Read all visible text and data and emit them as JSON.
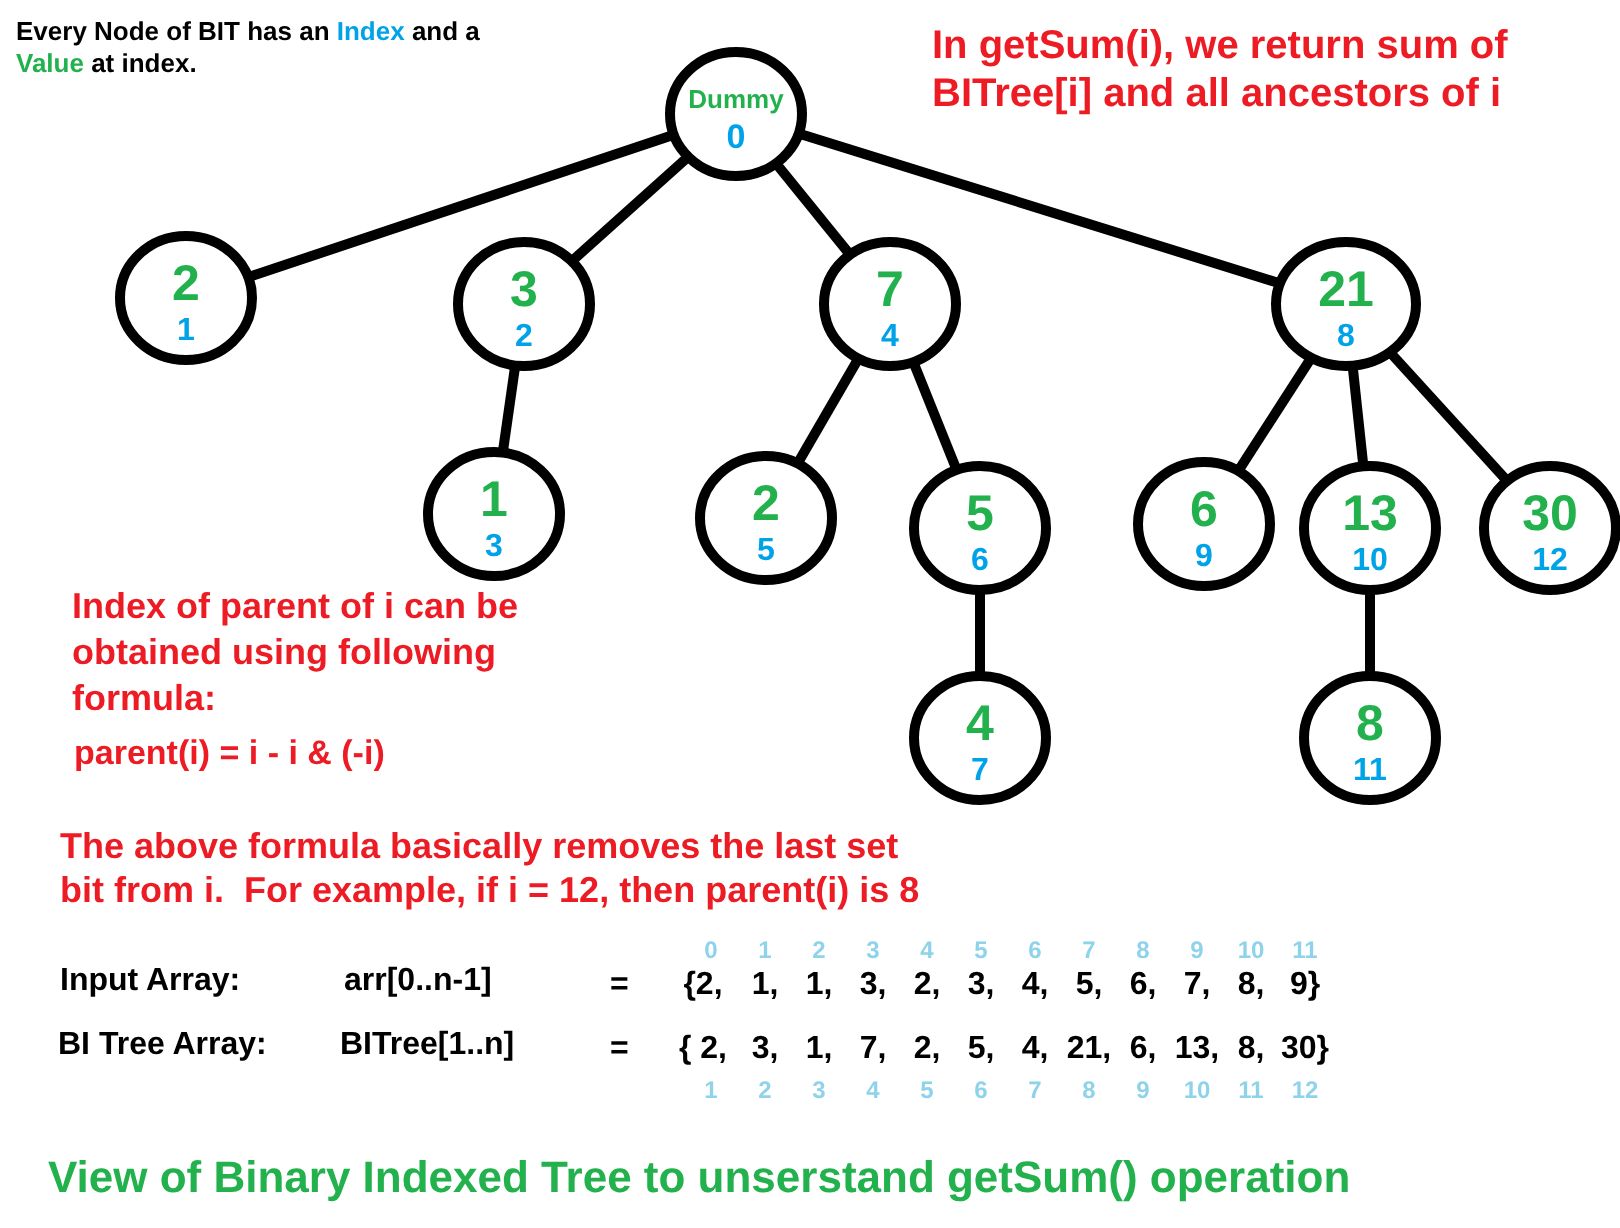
{
  "intro": [
    {
      "kind": "plain",
      "text": "Every Node of BIT has an "
    },
    {
      "kind": "index",
      "text": "Index"
    },
    {
      "kind": "plain",
      "text": " and a "
    },
    {
      "kind": "value",
      "text": "Value"
    },
    {
      "kind": "plain",
      "text": " at index."
    }
  ],
  "tree": {
    "value": "Dummy",
    "index": "0",
    "children": [
      {
        "value": "2",
        "index": "1"
      },
      {
        "value": "3",
        "index": "2",
        "children": [
          {
            "value": "1",
            "index": "3"
          }
        ]
      },
      {
        "value": "7",
        "index": "4",
        "children": [
          {
            "value": "2",
            "index": "5"
          },
          {
            "value": "5",
            "index": "6",
            "children": [
              {
                "value": "4",
                "index": "7"
              }
            ]
          }
        ]
      },
      {
        "value": "21",
        "index": "8",
        "children": [
          {
            "value": "6",
            "index": "9"
          },
          {
            "value": "13",
            "index": "10",
            "children": [
              {
                "value": "8",
                "index": "11"
              }
            ]
          },
          {
            "value": "30",
            "index": "12"
          }
        ]
      }
    ]
  },
  "get_sum_note": {
    "lines": [
      "In getSum(i), we return sum of",
      "BITree[i] and all ancestors of i"
    ]
  },
  "parent_note": {
    "lines": [
      "Index of parent of i can be",
      "obtained using following",
      "formula:"
    ]
  },
  "formula": "parent(i) = i - i & (-i)",
  "explanation": {
    "lines": [
      "The above formula basically removes the last set",
      "bit from i.  For example, if i = 12, then parent(i) is 8"
    ]
  },
  "arrays": [
    {
      "kind": "input",
      "label": "Input Array:",
      "name": "arr[0..n-1]",
      "equals": "=",
      "items": [
        "{2,",
        "1,",
        "1,",
        "3,",
        "2,",
        "3,",
        "4,",
        "5,",
        "6,",
        "7,",
        "8,",
        "9}"
      ],
      "indices": [
        "0",
        "1",
        "2",
        "3",
        "4",
        "5",
        "6",
        "7",
        "8",
        "9",
        "10",
        "11"
      ]
    },
    {
      "kind": "tree",
      "label": "BI Tree Array:",
      "name": "BITree[1..n]",
      "equals": "=",
      "items": [
        "{ 2,",
        "3,",
        "1,",
        "7,",
        "2,",
        "5,",
        "4,",
        "21,",
        "6,",
        "13,",
        "8,",
        "30}"
      ],
      "indices": [
        "1",
        "2",
        "3",
        "4",
        "5",
        "6",
        "7",
        "8",
        "9",
        "10",
        "11",
        "12"
      ]
    }
  ],
  "caption": "View of Binary Indexed Tree to unserstand getSum() operation"
}
